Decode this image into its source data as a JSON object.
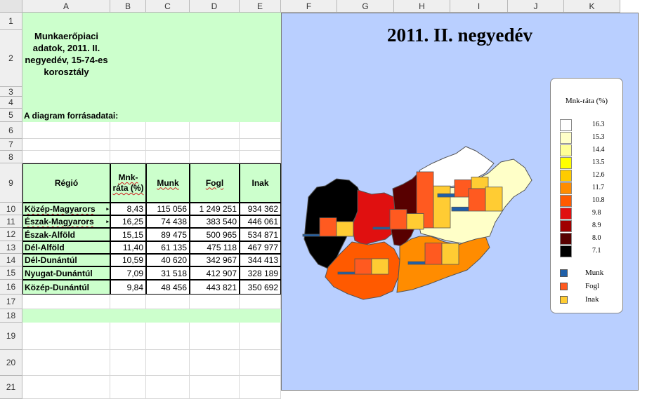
{
  "columns": [
    "A",
    "B",
    "C",
    "D",
    "E",
    "F",
    "G",
    "H",
    "I",
    "J",
    "K"
  ],
  "rows": [
    "1",
    "2",
    "3",
    "4",
    "5",
    "6",
    "7",
    "8",
    "9",
    "10",
    "11",
    "12",
    "13",
    "14",
    "15",
    "16",
    "17",
    "18",
    "19",
    "20",
    "21"
  ],
  "title_block": "Munkaerőpiaci adatok, 2011. II. negyedév, 15-74-es korosztály",
  "source_label": "A diagram forrásadatai:",
  "headers": {
    "region": "Régió",
    "rate": "Mnk-ráta (%)",
    "munk": "Munk",
    "fogl": "Fogl",
    "inak": "Inak"
  },
  "table": [
    {
      "region": "Közép-Magyarors",
      "rate": "8,43",
      "munk": "115 056",
      "fogl": "1 249 251",
      "inak": "934 362"
    },
    {
      "region": "Észak-Magyarors",
      "rate": "16,25",
      "munk": "74 438",
      "fogl": "383 540",
      "inak": "446 061"
    },
    {
      "region": "Észak-Alföld",
      "rate": "15,15",
      "munk": "89 475",
      "fogl": "500 965",
      "inak": "534 871"
    },
    {
      "region": "Dél-Alföld",
      "rate": "11,40",
      "munk": "61 135",
      "fogl": "475 118",
      "inak": "467 977"
    },
    {
      "region": "Dél-Dunántúl",
      "rate": "10,59",
      "munk": "40 620",
      "fogl": "342 967",
      "inak": "344 413"
    },
    {
      "region": "Nyugat-Dunántúl",
      "rate": "7,09",
      "munk": "31 518",
      "fogl": "412 907",
      "inak": "328 189"
    },
    {
      "region": "Közép-Dunántúl",
      "rate": "9,84",
      "munk": "48 456",
      "fogl": "443 821",
      "inak": "350 692"
    }
  ],
  "chart_data": {
    "type": "map",
    "title": "2011. II. negyedév",
    "legend_title": "Mnk-ráta (%)",
    "scale": [
      {
        "label": "16.3",
        "color": "#ffffff"
      },
      {
        "label": "15.3",
        "color": "#ffffc8"
      },
      {
        "label": "14.4",
        "color": "#ffff96"
      },
      {
        "label": "13.5",
        "color": "#ffff00"
      },
      {
        "label": "12.6",
        "color": "#ffcc00"
      },
      {
        "label": "11.7",
        "color": "#ff8c00"
      },
      {
        "label": "10.8",
        "color": "#ff5a00"
      },
      {
        "label": "9.8",
        "color": "#e01010"
      },
      {
        "label": "8.9",
        "color": "#a00000"
      },
      {
        "label": "8.0",
        "color": "#580000"
      },
      {
        "label": "7.1",
        "color": "#000000"
      }
    ],
    "series": [
      {
        "name": "Munk",
        "color": "#1f5fa8"
      },
      {
        "name": "Fogl",
        "color": "#ff5a20"
      },
      {
        "name": "Inak",
        "color": "#ffcc33"
      }
    ],
    "regions": [
      {
        "name": "Közép-Magyarország",
        "rate": 8.43,
        "munk": 115056,
        "fogl": 1249251,
        "inak": 934362
      },
      {
        "name": "Észak-Magyarország",
        "rate": 16.25,
        "munk": 74438,
        "fogl": 383540,
        "inak": 446061
      },
      {
        "name": "Észak-Alföld",
        "rate": 15.15,
        "munk": 89475,
        "fogl": 500965,
        "inak": 534871
      },
      {
        "name": "Dél-Alföld",
        "rate": 11.4,
        "munk": 61135,
        "fogl": 475118,
        "inak": 467977
      },
      {
        "name": "Dél-Dunántúl",
        "rate": 10.59,
        "munk": 40620,
        "fogl": 342967,
        "inak": 344413
      },
      {
        "name": "Nyugat-Dunántúl",
        "rate": 7.09,
        "munk": 31518,
        "fogl": 412907,
        "inak": 328189
      },
      {
        "name": "Közép-Dunántúl",
        "rate": 9.84,
        "munk": 48456,
        "fogl": 443821,
        "inak": 350692
      }
    ]
  }
}
